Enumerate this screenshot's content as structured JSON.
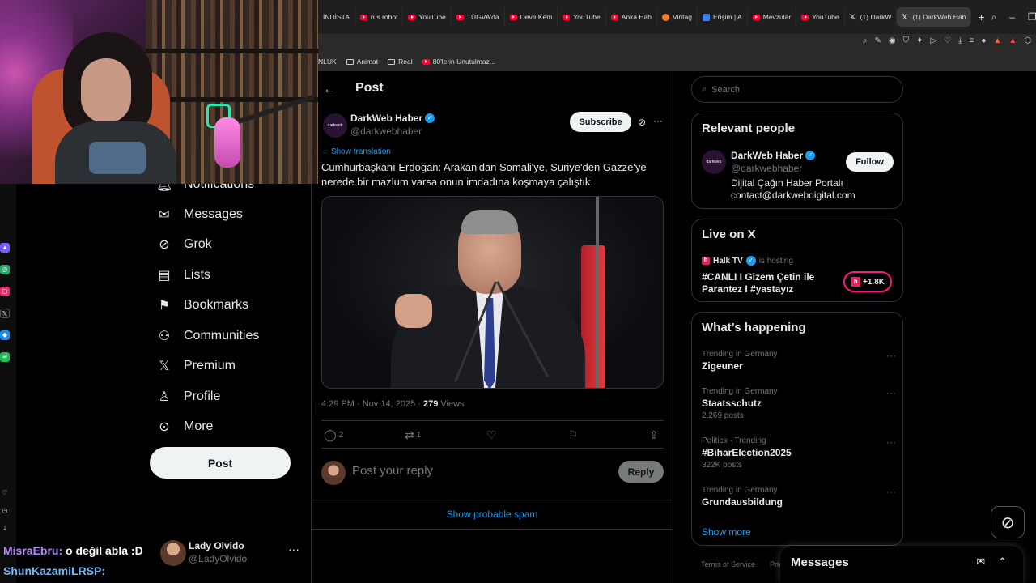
{
  "browser": {
    "tabs": [
      {
        "label": "İNDİSTA",
        "icon": "none"
      },
      {
        "label": "rus robot",
        "icon": "youtube-icon"
      },
      {
        "label": "YouTube",
        "icon": "youtube-icon"
      },
      {
        "label": "TÜGVA'da",
        "icon": "youtube-icon"
      },
      {
        "label": "Deve Kem",
        "icon": "youtube-icon"
      },
      {
        "label": "YouTube",
        "icon": "youtube-icon"
      },
      {
        "label": "Anka Hab",
        "icon": "youtube-icon"
      },
      {
        "label": "Vintag",
        "icon": "fire-icon"
      },
      {
        "label": "Erişim | A",
        "icon": "generic-icon"
      },
      {
        "label": "Mevzular",
        "icon": "youtube-icon"
      },
      {
        "label": "YouTube",
        "icon": "youtube-icon"
      },
      {
        "label": "(1) DarkW",
        "icon": "x-icon"
      },
      {
        "label": "(1) DarkWeb Hab",
        "icon": "x-icon"
      }
    ],
    "bookmarks": [
      {
        "label": "NLUK"
      },
      {
        "label": "Animat"
      },
      {
        "label": "Real"
      },
      {
        "label": "80'lerin Unutulmaz..."
      }
    ]
  },
  "nav": {
    "items": [
      {
        "label": "Notifications",
        "icon": "bell-icon"
      },
      {
        "label": "Messages",
        "icon": "envelope-icon"
      },
      {
        "label": "Grok",
        "icon": "grok-icon"
      },
      {
        "label": "Lists",
        "icon": "list-icon"
      },
      {
        "label": "Bookmarks",
        "icon": "bookmark-icon"
      },
      {
        "label": "Communities",
        "icon": "communities-icon"
      },
      {
        "label": "Premium",
        "icon": "x-logo-icon"
      },
      {
        "label": "Profile",
        "icon": "person-icon"
      },
      {
        "label": "More",
        "icon": "more-circle-icon"
      }
    ],
    "post_label": "Post",
    "account": {
      "name": "Lady Olvido",
      "handle": "@LadyOlvido"
    }
  },
  "chat": {
    "line1_user": "MisraEbru:",
    "line1_msg": "o değil abla :D",
    "line2_user": "ShunKazamiLRSP:"
  },
  "post": {
    "header_title": "Post",
    "author_name": "DarkWeb Haber",
    "author_handle": "@darkwebhaber",
    "avatar_text": "darkweb",
    "subscribe_label": "Subscribe",
    "show_translation": "Show translation",
    "text": "Cumhurbaşkanı Erdoğan: Arakan'dan Somali'ye, Suriye'den Gazze'ye nerede bir mazlum varsa onun imdadına koşmaya çalıştık.",
    "timestamp": "4:29 PM · Nov 14, 2025 · ",
    "views_count": "279",
    "views_label": " Views",
    "replies": "2",
    "reposts": "1",
    "reply_placeholder": "Post your reply",
    "reply_label": "Reply",
    "spam_link": "Show probable spam"
  },
  "sidebar": {
    "search_placeholder": "Search",
    "relevant_title": "Relevant people",
    "relevant": {
      "name": "DarkWeb Haber",
      "handle": "@darkwebhaber",
      "bio": "Dijital Çağın Haber Portalı | contact@darkwebdigital.com",
      "follow_label": "Follow",
      "avatar_text": "darkweb"
    },
    "live_title": "Live on X",
    "live": {
      "host": "Halk TV",
      "hosting": "is hosting",
      "title": "#CANLI I Gizem Çetin ile Parantez I #yastayız",
      "count": "+1.8K"
    },
    "happening_title": "What’s happening",
    "trends": [
      {
        "context": "Trending in Germany",
        "topic": "Zigeuner",
        "count": ""
      },
      {
        "context": "Trending in Germany",
        "topic": "Staatsschutz",
        "count": "2,269 posts"
      },
      {
        "context": "Politics · Trending",
        "topic": "#BiharElection2025",
        "count": "322K posts"
      },
      {
        "context": "Trending in Germany",
        "topic": "Grundausbildung",
        "count": ""
      }
    ],
    "show_more": "Show more",
    "footer": [
      "Terms of Service",
      "Priva"
    ]
  },
  "messages_drawer": {
    "title": "Messages"
  },
  "colors": {
    "accent": "#1d9bf0",
    "background": "#000000",
    "border": "#2f3336",
    "muted": "#71767b",
    "live": "#f91880"
  }
}
